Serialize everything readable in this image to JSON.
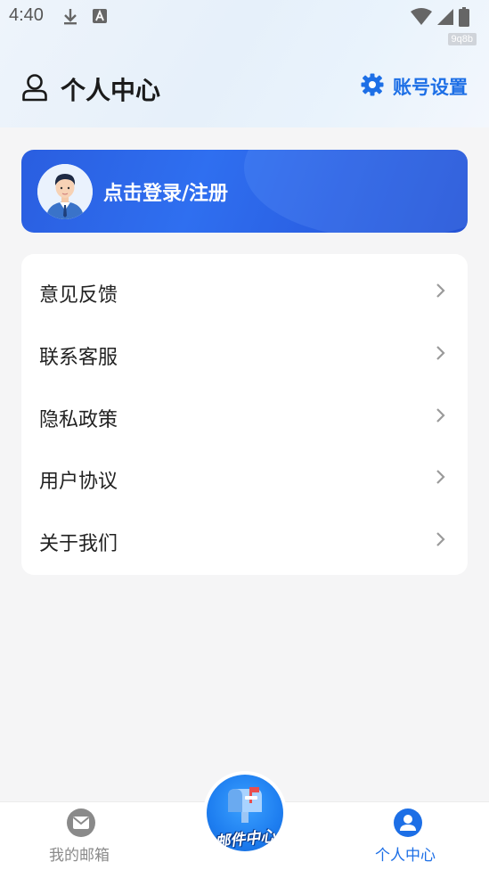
{
  "status_bar": {
    "time": "4:40",
    "watermark": "9q8b"
  },
  "header": {
    "title": "个人中心",
    "settings_label": "账号设置"
  },
  "login_card": {
    "label": "点击登录/注册"
  },
  "menu": {
    "items": [
      {
        "label": "意见反馈"
      },
      {
        "label": "联系客服"
      },
      {
        "label": "隐私政策"
      },
      {
        "label": "用户协议"
      },
      {
        "label": "关于我们"
      }
    ]
  },
  "tabbar": {
    "tabs": [
      {
        "label": "我的邮箱",
        "icon": "mail-icon",
        "active": false
      },
      {
        "label": "邮件中心",
        "icon": "mailbox-icon",
        "active": false
      },
      {
        "label": "个人中心",
        "icon": "user-icon",
        "active": true
      }
    ]
  },
  "colors": {
    "accent": "#1d6fe6",
    "login_card": "#2a5ee0",
    "inactive_tab": "#8a8a8a"
  }
}
